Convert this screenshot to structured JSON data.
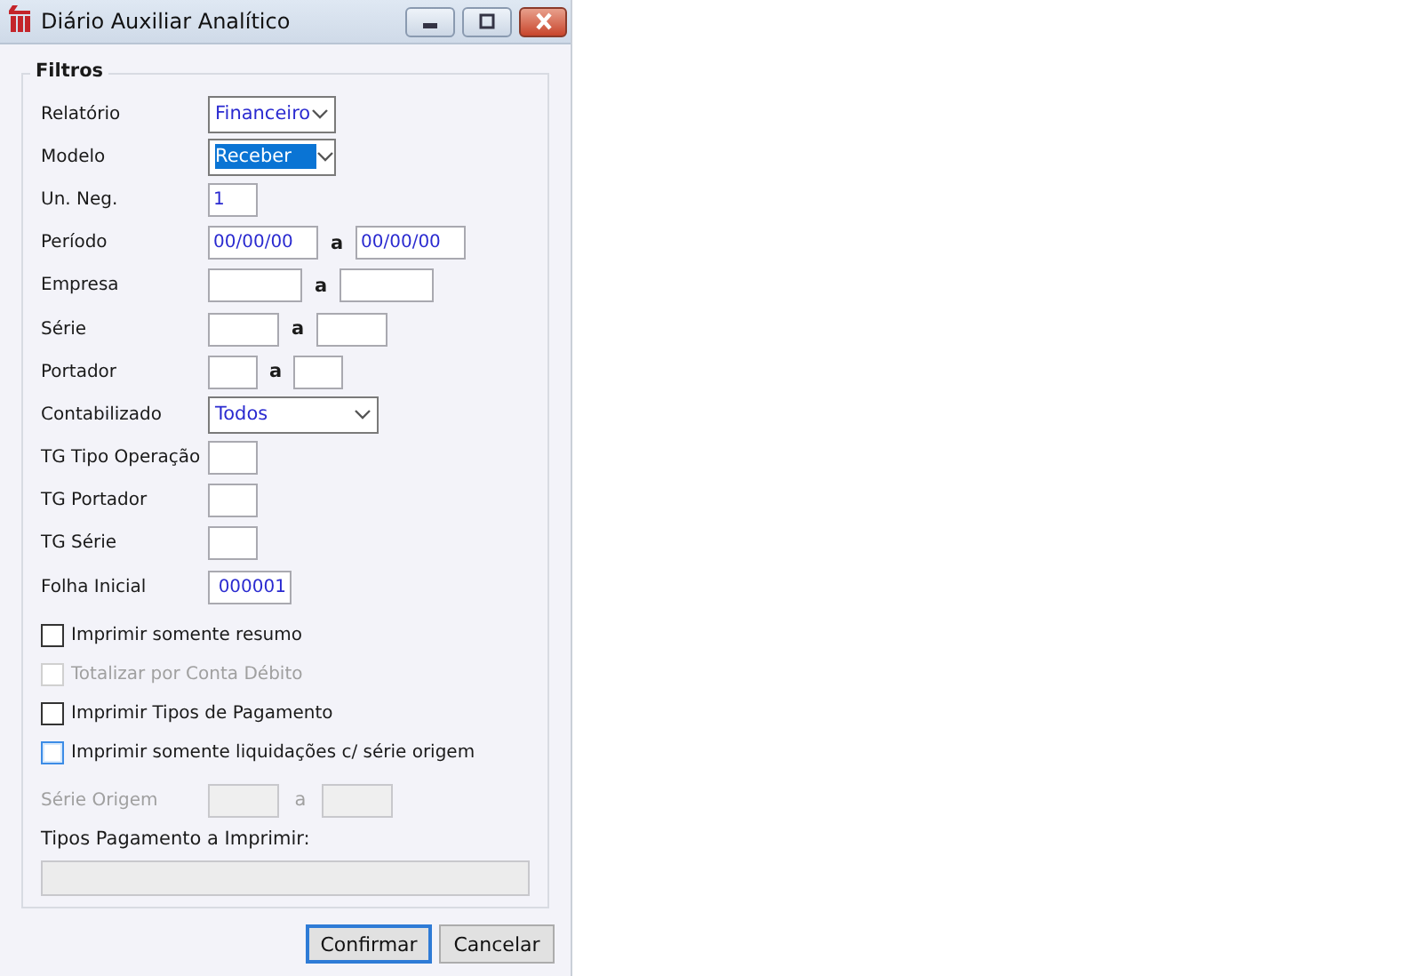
{
  "window": {
    "title": "Diário Auxiliar Analítico"
  },
  "group": {
    "title": "Filtros"
  },
  "rows": [
    {
      "label": "Relatório",
      "kind": "combo",
      "fields": [
        {
          "value": "Financeiro",
          "text_selected": false
        }
      ]
    },
    {
      "label": "Modelo",
      "kind": "combo",
      "fields": [
        {
          "value": "Receber",
          "text_selected": true
        }
      ]
    },
    {
      "label": "Un. Neg.",
      "kind": "input",
      "fields": [
        {
          "kind": "text",
          "value": "1"
        }
      ]
    },
    {
      "label": "Período",
      "kind": "input",
      "separator": "a",
      "fields": [
        {
          "kind": "text",
          "value": "00/00/00"
        },
        {
          "kind": "text",
          "value": "00/00/00"
        }
      ]
    },
    {
      "label": "Empresa",
      "kind": "input",
      "separator": "a",
      "fields": [
        {
          "kind": "blank"
        },
        {
          "kind": "blank"
        }
      ]
    },
    {
      "label": "Série",
      "kind": "input",
      "separator": "a",
      "fields": [
        {
          "kind": "blank"
        },
        {
          "kind": "blank"
        }
      ]
    },
    {
      "label": "Portador",
      "kind": "input",
      "separator": "a",
      "fields": [
        {
          "kind": "blank"
        },
        {
          "kind": "blank"
        }
      ]
    },
    {
      "label": "Contabilizado",
      "kind": "combo",
      "fields": [
        {
          "value": "Todos",
          "text_selected": false
        }
      ]
    },
    {
      "label": "TG Tipo Operação",
      "kind": "input",
      "fields": [
        {
          "kind": "blank"
        }
      ]
    },
    {
      "label": "TG Portador",
      "kind": "input",
      "fields": [
        {
          "kind": "blank"
        }
      ]
    },
    {
      "label": "TG Série",
      "kind": "input",
      "fields": [
        {
          "kind": "blank"
        }
      ]
    },
    {
      "label": "Folha Inicial",
      "kind": "input",
      "fields": [
        {
          "kind": "number",
          "value": "000001"
        }
      ]
    }
  ],
  "checkboxes": [
    {
      "label": "Imprimir somente resumo",
      "checked": false,
      "disabled": false,
      "focused": false
    },
    {
      "label": "Totalizar por Conta Débito",
      "checked": false,
      "disabled": true,
      "focused": false
    },
    {
      "label": "Imprimir Tipos de Pagamento",
      "checked": false,
      "disabled": false,
      "focused": false
    },
    {
      "label": "Imprimir somente liquidações c/ série origem",
      "checked": false,
      "disabled": false,
      "focused": true
    }
  ],
  "serie_origem": {
    "label": "Série Origem",
    "separator": "a",
    "disabled": true
  },
  "tipos_pagamento": {
    "label": "Tipos Pagamento a Imprimir:",
    "disabled": true
  },
  "buttons": [
    {
      "label": "Confirmar",
      "default": true
    },
    {
      "label": "Cancelar",
      "default": false
    }
  ]
}
